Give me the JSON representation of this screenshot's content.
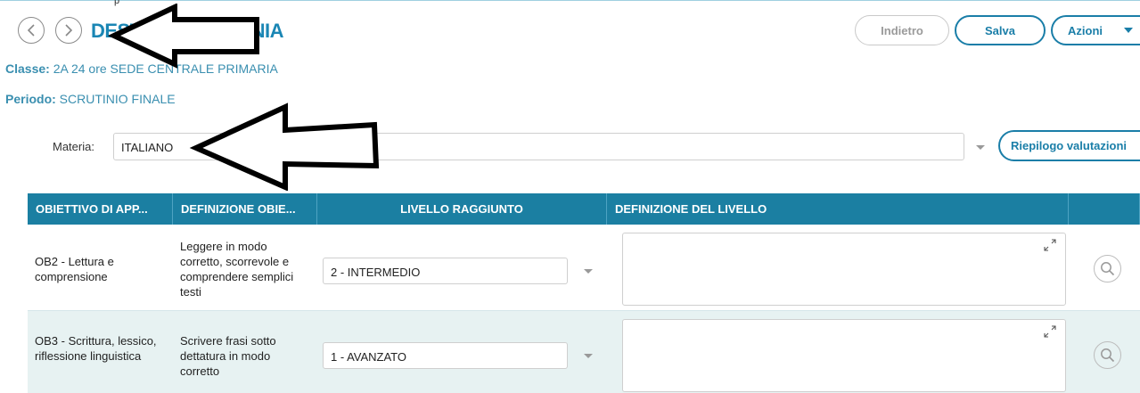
{
  "header": {
    "top_scrap": "p",
    "student_name": "DESTEFANIS YLENIA",
    "classe_label": "Classe:",
    "classe_value": "2A 24 ore SEDE CENTRALE PRIMARIA",
    "periodo_label": "Periodo:",
    "periodo_value": "SCRUTINIO FINALE"
  },
  "toolbar": {
    "back_label": "Indietro",
    "save_label": "Salva",
    "actions_label": "Azioni"
  },
  "subject": {
    "label": "Materia:",
    "value": "ITALIANO",
    "summary_button": "Riepilogo valutazioni"
  },
  "table": {
    "columns": [
      "OBIETTIVO DI APP...",
      "DEFINIZIONE OBIE...",
      "LIVELLO RAGGIUNTO",
      "DEFINIZIONE DEL LIVELLO",
      ""
    ],
    "rows": [
      {
        "objective": "OB2 - Lettura e comprensione",
        "definition": "Leggere in modo corretto, scorrevole e comprendere semplici testi",
        "level": "2 - INTERMEDIO",
        "level_definition": ""
      },
      {
        "objective": "OB3 - Scrittura, lessico, riflessione linguistica",
        "definition": "Scrivere frasi sotto dettatura in modo corretto",
        "level": "1 - AVANZATO",
        "level_definition": ""
      }
    ]
  },
  "colors": {
    "accent": "#1a7ea8",
    "header_bg": "#1b7fa2",
    "row_alt": "#e7f2f2"
  },
  "icons": [
    "chevron-left-icon",
    "chevron-right-icon",
    "caret-down-icon",
    "expand-icon",
    "search-icon",
    "annotation-arrow"
  ]
}
